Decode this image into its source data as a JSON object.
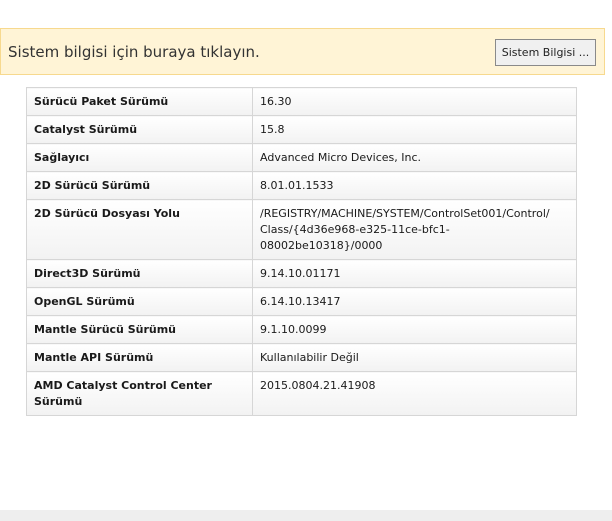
{
  "banner": {
    "text": "Sistem bilgisi için buraya tıklayın.",
    "button_label": "Sistem Bilgisi ..."
  },
  "rows": [
    {
      "key": "Sürücü Paket Sürümü",
      "value": "16.30"
    },
    {
      "key": "Catalyst Sürümü",
      "value": "15.8"
    },
    {
      "key": "Sağlayıcı",
      "value": "Advanced Micro Devices, Inc."
    },
    {
      "key": "2D Sürücü Sürümü",
      "value": "8.01.01.1533"
    },
    {
      "key": "2D Sürücü Dosyası Yolu",
      "value": "/REGISTRY/MACHINE/SYSTEM/ControlSet001/Control/",
      "value2": "Class/{4d36e968-e325-11ce-bfc1-08002be10318}/0000"
    },
    {
      "key": "Direct3D Sürümü",
      "value": "9.14.10.01171"
    },
    {
      "key": "OpenGL Sürümü",
      "value": "6.14.10.13417"
    },
    {
      "key": "Mantle Sürücü Sürümü",
      "value": "9.1.10.0099"
    },
    {
      "key": "Mantle API Sürümü",
      "value": "Kullanılabilir Değil"
    },
    {
      "key": "AMD Catalyst Control Center Sürümü",
      "value": "2015.0804.21.41908"
    }
  ]
}
